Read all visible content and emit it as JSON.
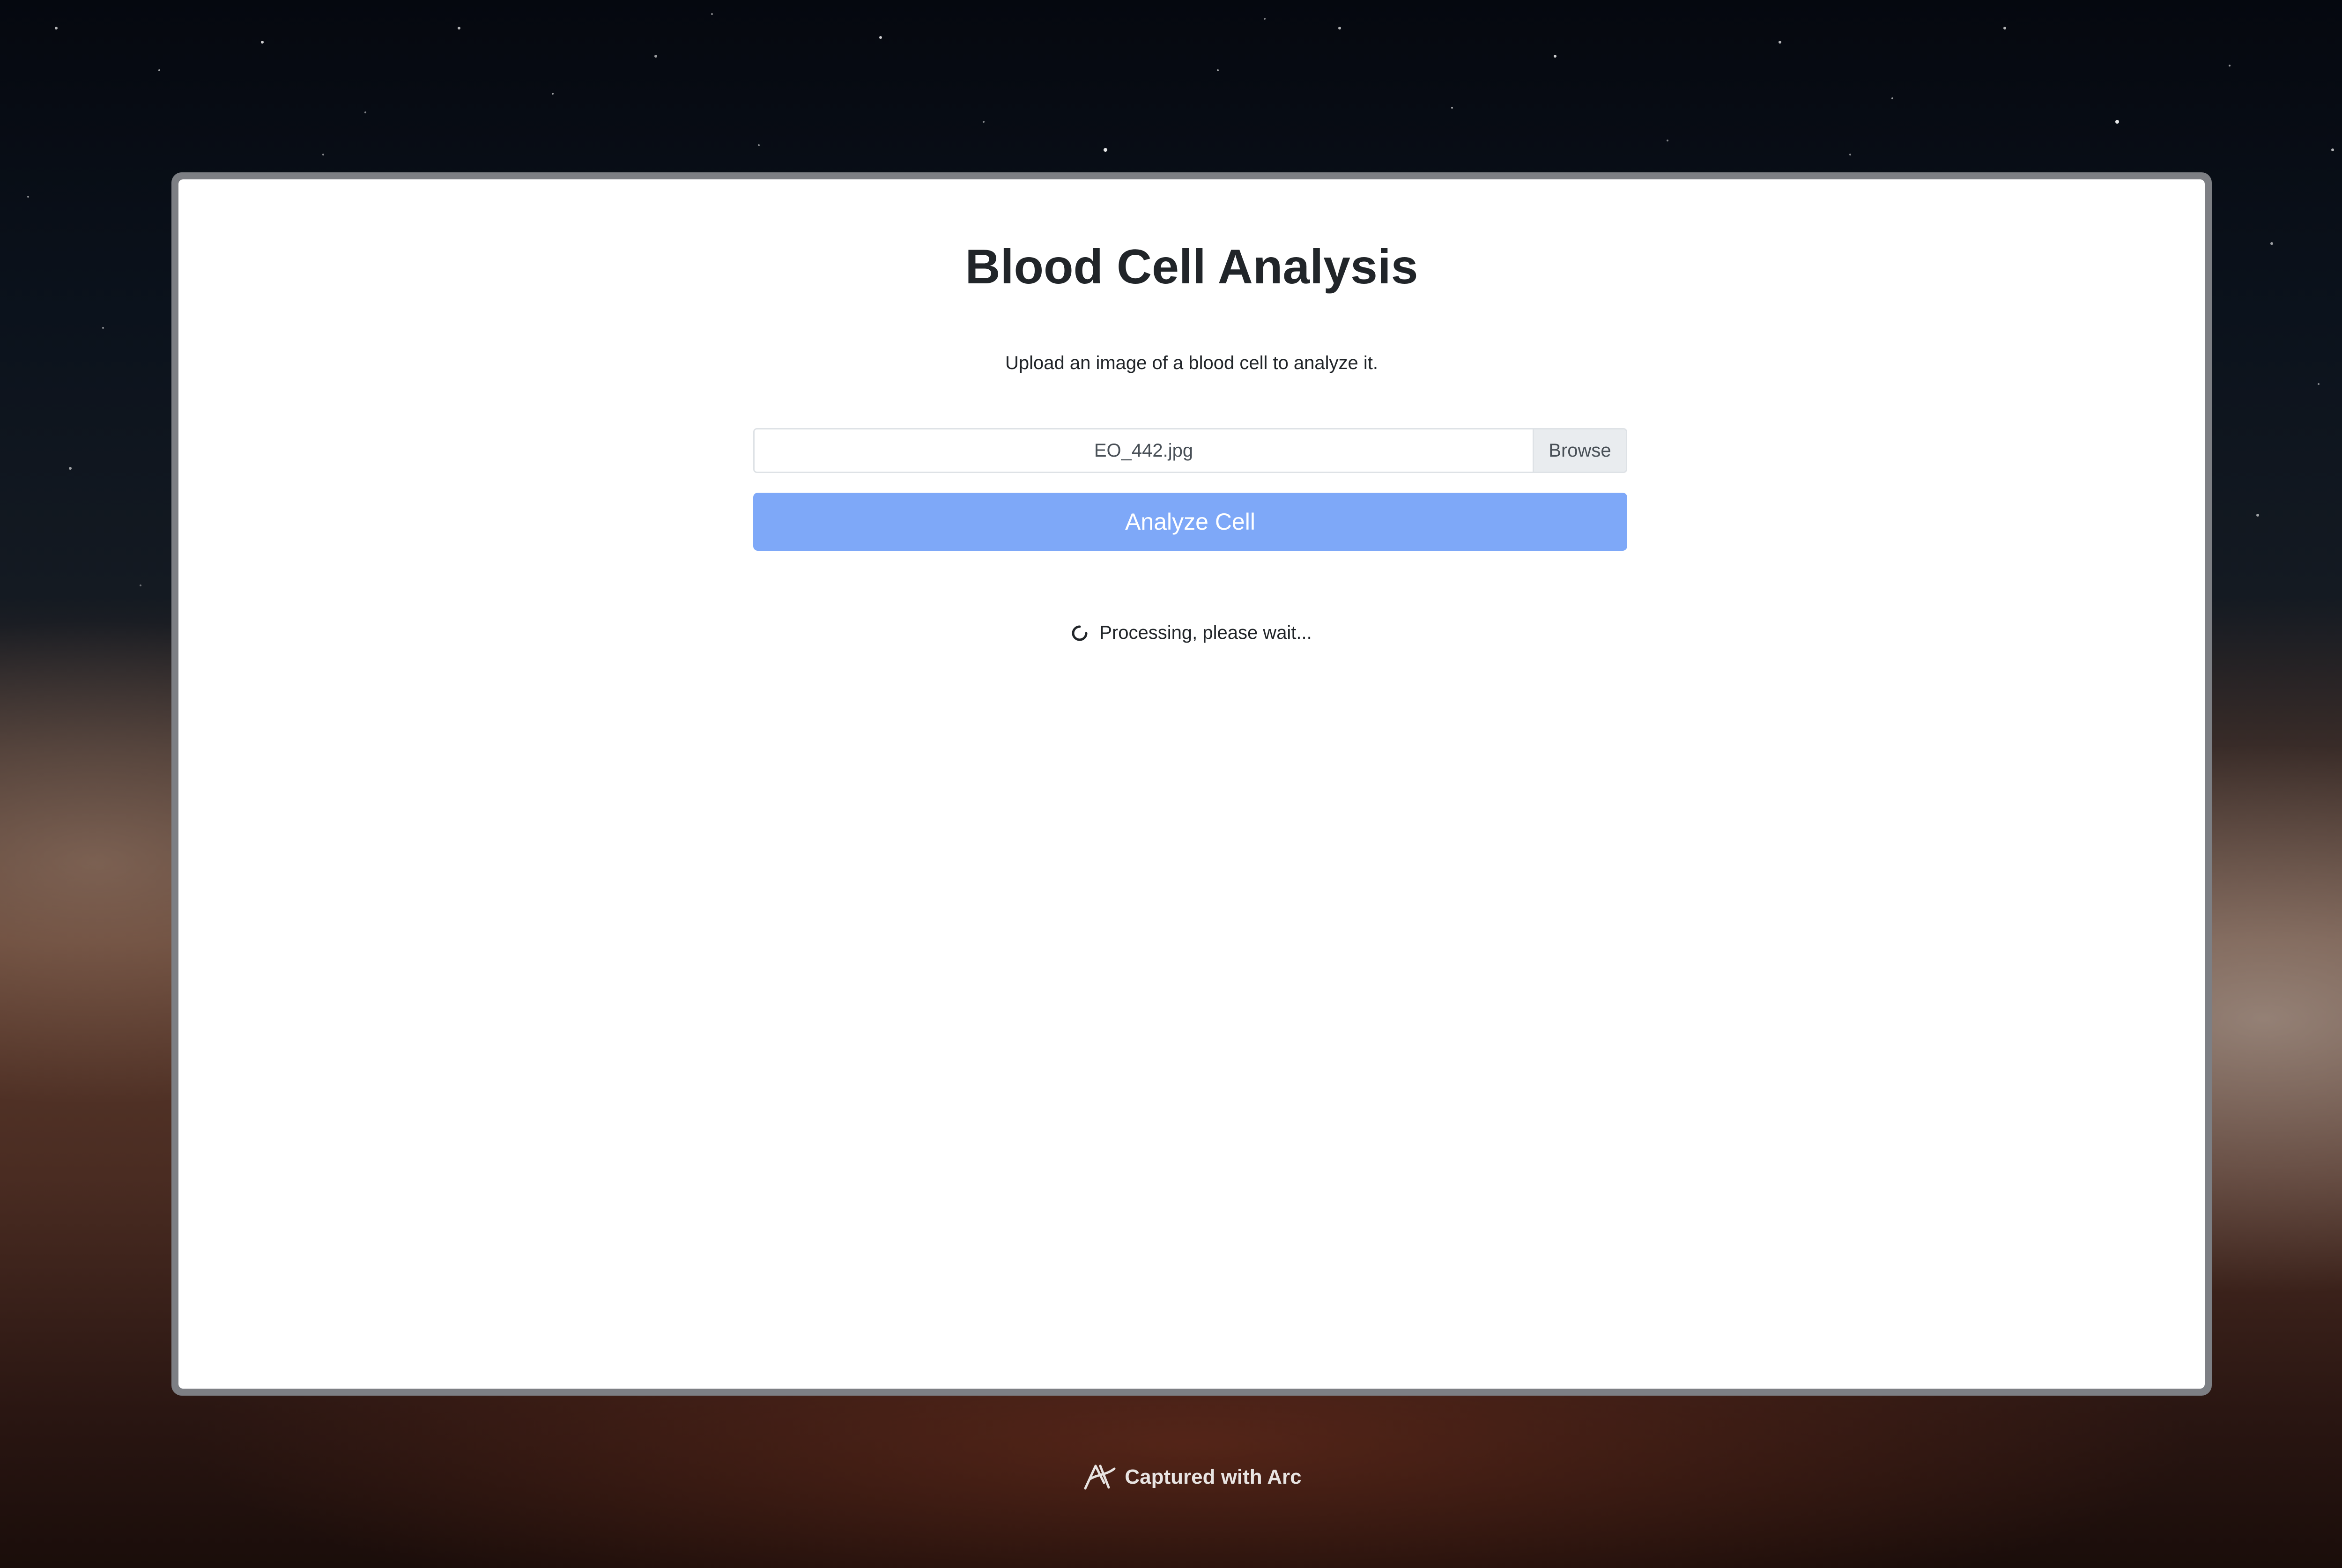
{
  "app": {
    "title": "Blood Cell Analysis",
    "subtitle": "Upload an image of a blood cell to analyze it."
  },
  "upload": {
    "file_name": "EO_442.jpg",
    "browse_label": "Browse"
  },
  "actions": {
    "analyze_label": "Analyze Cell",
    "analyze_color": "#7ea8f8"
  },
  "status": {
    "message": "Processing, please wait...",
    "icon": "spinner-icon"
  },
  "footer": {
    "captured_label": "Captured with Arc",
    "icon": "arc-logo-icon"
  }
}
